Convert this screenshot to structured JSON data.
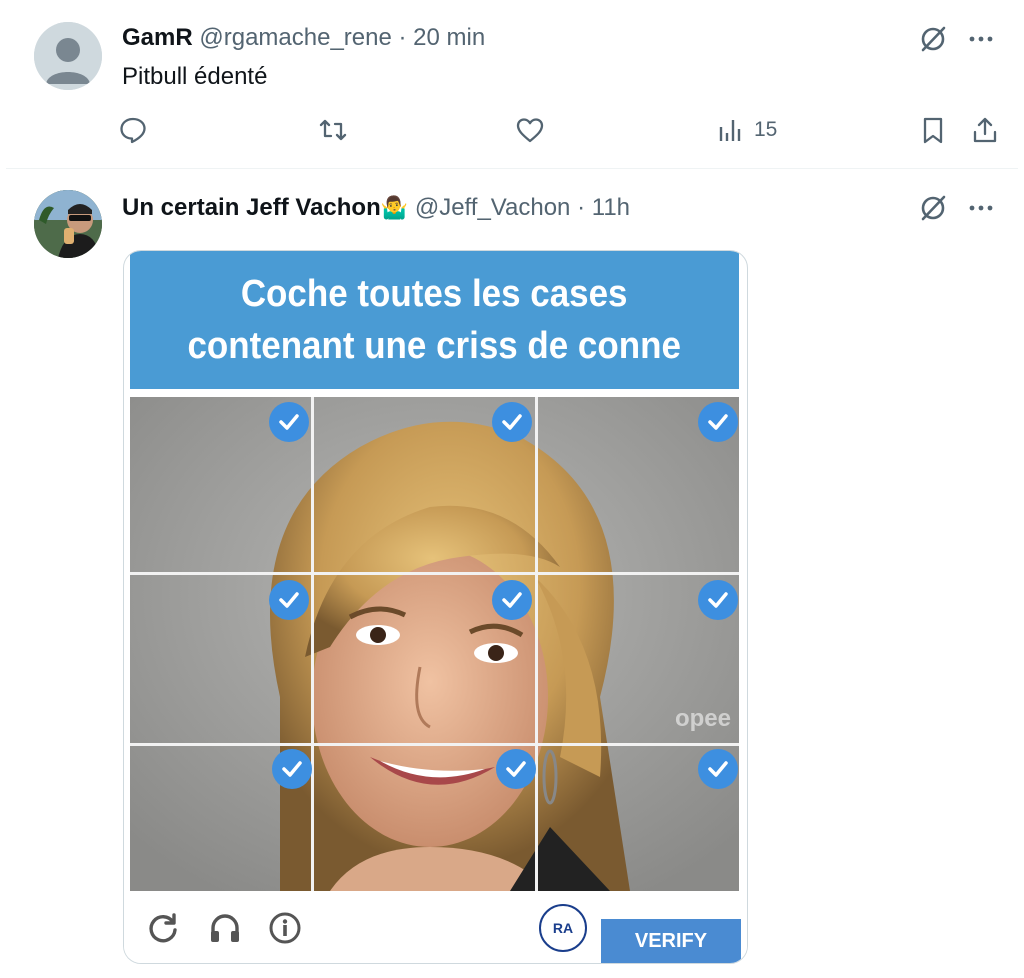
{
  "tweets": [
    {
      "name": "GamR",
      "handle": "@rgamache_rene",
      "separator": "·",
      "time": "20 min",
      "text": "Pitbull édenté",
      "views": "15"
    },
    {
      "name": "Un certain Jeff Vachon",
      "emoji": "🤷‍♂️",
      "handle": "@Jeff_Vachon",
      "separator": "·",
      "time": "11h",
      "media": {
        "captcha_line1": "Coche toutes les cases",
        "captcha_line2": "contenant une criss de conne",
        "watermark": "opee",
        "verify_label": "VERIFY",
        "logo_text": "RA",
        "checked_cells": 9
      }
    }
  ],
  "colors": {
    "accent_blue": "#4a9bd4",
    "check_blue": "#3d8fe0",
    "muted_text": "#536471"
  }
}
